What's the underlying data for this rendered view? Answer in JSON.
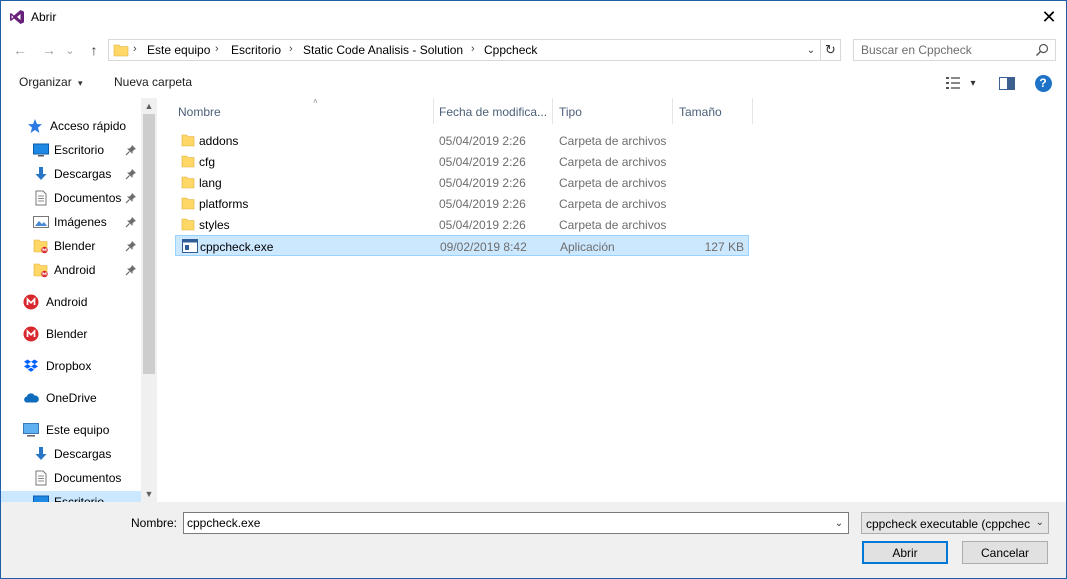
{
  "window": {
    "title": "Abrir",
    "close_glyph": "✕"
  },
  "navigation": {
    "back_glyph": "←",
    "forward_glyph": "→",
    "recent_glyph": "⌄",
    "up_glyph": "↑",
    "breadcrumbs": [
      "Este equipo",
      "Escritorio",
      "Static Code Analisis - Solution",
      "Cppcheck"
    ],
    "separator": "›",
    "refresh_glyph": "↻",
    "dropdown_glyph": "⌄"
  },
  "search": {
    "placeholder": "Buscar en Cppcheck"
  },
  "toolbar": {
    "organize_label": "Organizar",
    "organize_caret": "▾",
    "new_folder_label": "Nueva carpeta",
    "view_caret": "▾",
    "help_glyph": "?"
  },
  "sidebar": {
    "items": [
      {
        "label": "Acceso rápido",
        "icon": "star-icon",
        "pinned": false
      },
      {
        "label": "Escritorio",
        "icon": "desktop-icon",
        "pinned": true
      },
      {
        "label": "Descargas",
        "icon": "download-icon",
        "pinned": true
      },
      {
        "label": "Documentos",
        "icon": "documents-icon",
        "pinned": true
      },
      {
        "label": "Imágenes",
        "icon": "pictures-icon",
        "pinned": true
      },
      {
        "label": "Blender",
        "icon": "folder-badge-icon",
        "pinned": true
      },
      {
        "label": "Android",
        "icon": "folder-badge-icon",
        "pinned": true
      },
      {
        "label": "Android",
        "icon": "mega-icon",
        "pinned": false
      },
      {
        "label": "Blender",
        "icon": "mega-icon",
        "pinned": false
      },
      {
        "label": "Dropbox",
        "icon": "dropbox-icon",
        "pinned": false
      },
      {
        "label": "OneDrive",
        "icon": "onedrive-icon",
        "pinned": false
      },
      {
        "label": "Este equipo",
        "icon": "computer-icon",
        "pinned": false
      },
      {
        "label": "Descargas",
        "icon": "download-icon",
        "pinned": false
      },
      {
        "label": "Documentos",
        "icon": "documents-icon",
        "pinned": false
      },
      {
        "label": "Escritorio",
        "icon": "desktop-icon",
        "pinned": false
      }
    ],
    "scroll_up_glyph": "▲",
    "scroll_down_glyph": "▼"
  },
  "file_list": {
    "columns": [
      "Nombre",
      "Fecha de modifica...",
      "Tipo",
      "Tamaño"
    ],
    "sort_glyph": "˄",
    "rows": [
      {
        "name": "addons",
        "date": "05/04/2019 2:26",
        "type": "Carpeta de archivos",
        "size": "",
        "icon": "folder-icon",
        "selected": false
      },
      {
        "name": "cfg",
        "date": "05/04/2019 2:26",
        "type": "Carpeta de archivos",
        "size": "",
        "icon": "folder-icon",
        "selected": false
      },
      {
        "name": "lang",
        "date": "05/04/2019 2:26",
        "type": "Carpeta de archivos",
        "size": "",
        "icon": "folder-icon",
        "selected": false
      },
      {
        "name": "platforms",
        "date": "05/04/2019 2:26",
        "type": "Carpeta de archivos",
        "size": "",
        "icon": "folder-icon",
        "selected": false
      },
      {
        "name": "styles",
        "date": "05/04/2019 2:26",
        "type": "Carpeta de archivos",
        "size": "",
        "icon": "folder-icon",
        "selected": false
      },
      {
        "name": "cppcheck.exe",
        "date": "09/02/2019 8:42",
        "type": "Aplicación",
        "size": "127 KB",
        "icon": "application-icon",
        "selected": true
      }
    ]
  },
  "footer": {
    "filename_label": "Nombre:",
    "filename_value": "cppcheck.exe",
    "filetype_value": "cppcheck executable (cppcheck.exe)",
    "dropdown_glyph": "⌄",
    "open_button": "Abrir",
    "cancel_button": "Cancelar"
  },
  "colors": {
    "accent": "#0078d7",
    "selection": "#cce8ff",
    "selection_border": "#99d1ff",
    "folder": "#ffd766",
    "header_text": "#4c607a",
    "mega_red": "#d9272e"
  }
}
